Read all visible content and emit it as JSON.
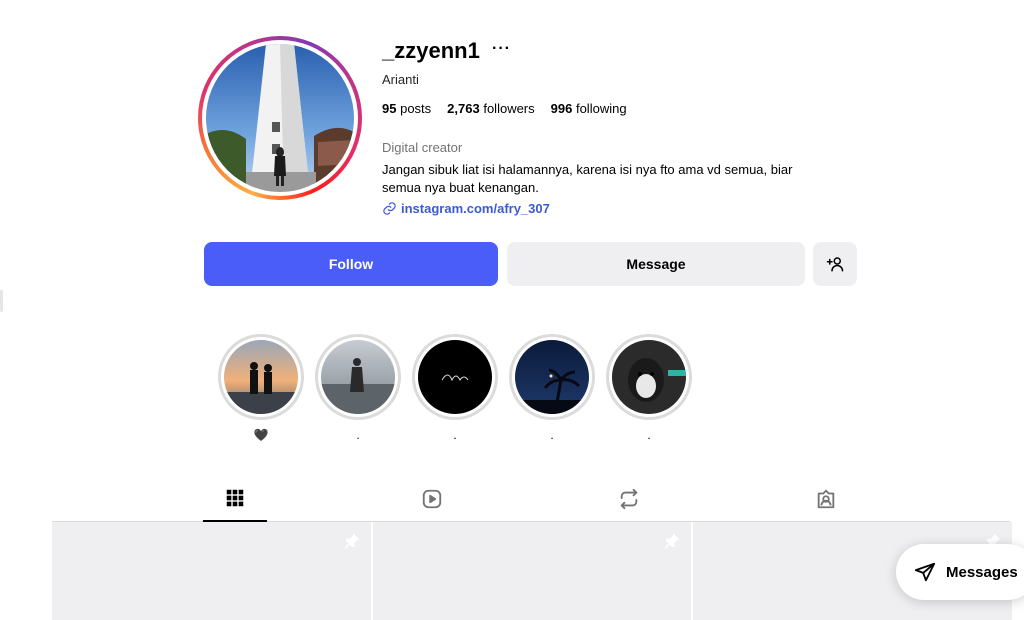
{
  "profile": {
    "username": "_zzyenn1",
    "more_icon": "···",
    "full_name": "Arianti",
    "stats": {
      "posts_count": "95",
      "posts_label": "posts",
      "followers_count": "2,763",
      "followers_label": "followers",
      "following_count": "996",
      "following_label": "following"
    },
    "category": "Digital creator",
    "bio": "Jangan sibuk liat isi halamannya, karena isi nya fto ama vd semua, biar semua nya buat kenangan.",
    "link": "instagram.com/afry_307",
    "link_icon": "link-icon"
  },
  "actions": {
    "follow_label": "Follow",
    "message_label": "Message",
    "suggest_icon": "add-person-icon"
  },
  "highlights": [
    {
      "label": "🖤"
    },
    {
      "label": "."
    },
    {
      "label": "."
    },
    {
      "label": "."
    },
    {
      "label": "."
    }
  ],
  "tabs": [
    {
      "name": "posts",
      "icon": "grid-icon",
      "active": true
    },
    {
      "name": "reels",
      "icon": "reels-icon",
      "active": false
    },
    {
      "name": "reposts",
      "icon": "repost-icon",
      "active": false
    },
    {
      "name": "tagged",
      "icon": "tagged-icon",
      "active": false
    }
  ],
  "floating": {
    "messages_label": "Messages",
    "messages_icon": "send-icon"
  },
  "colors": {
    "accent": "#4a5df9",
    "link": "#3b5ad5",
    "button_gray": "#efeff1"
  }
}
